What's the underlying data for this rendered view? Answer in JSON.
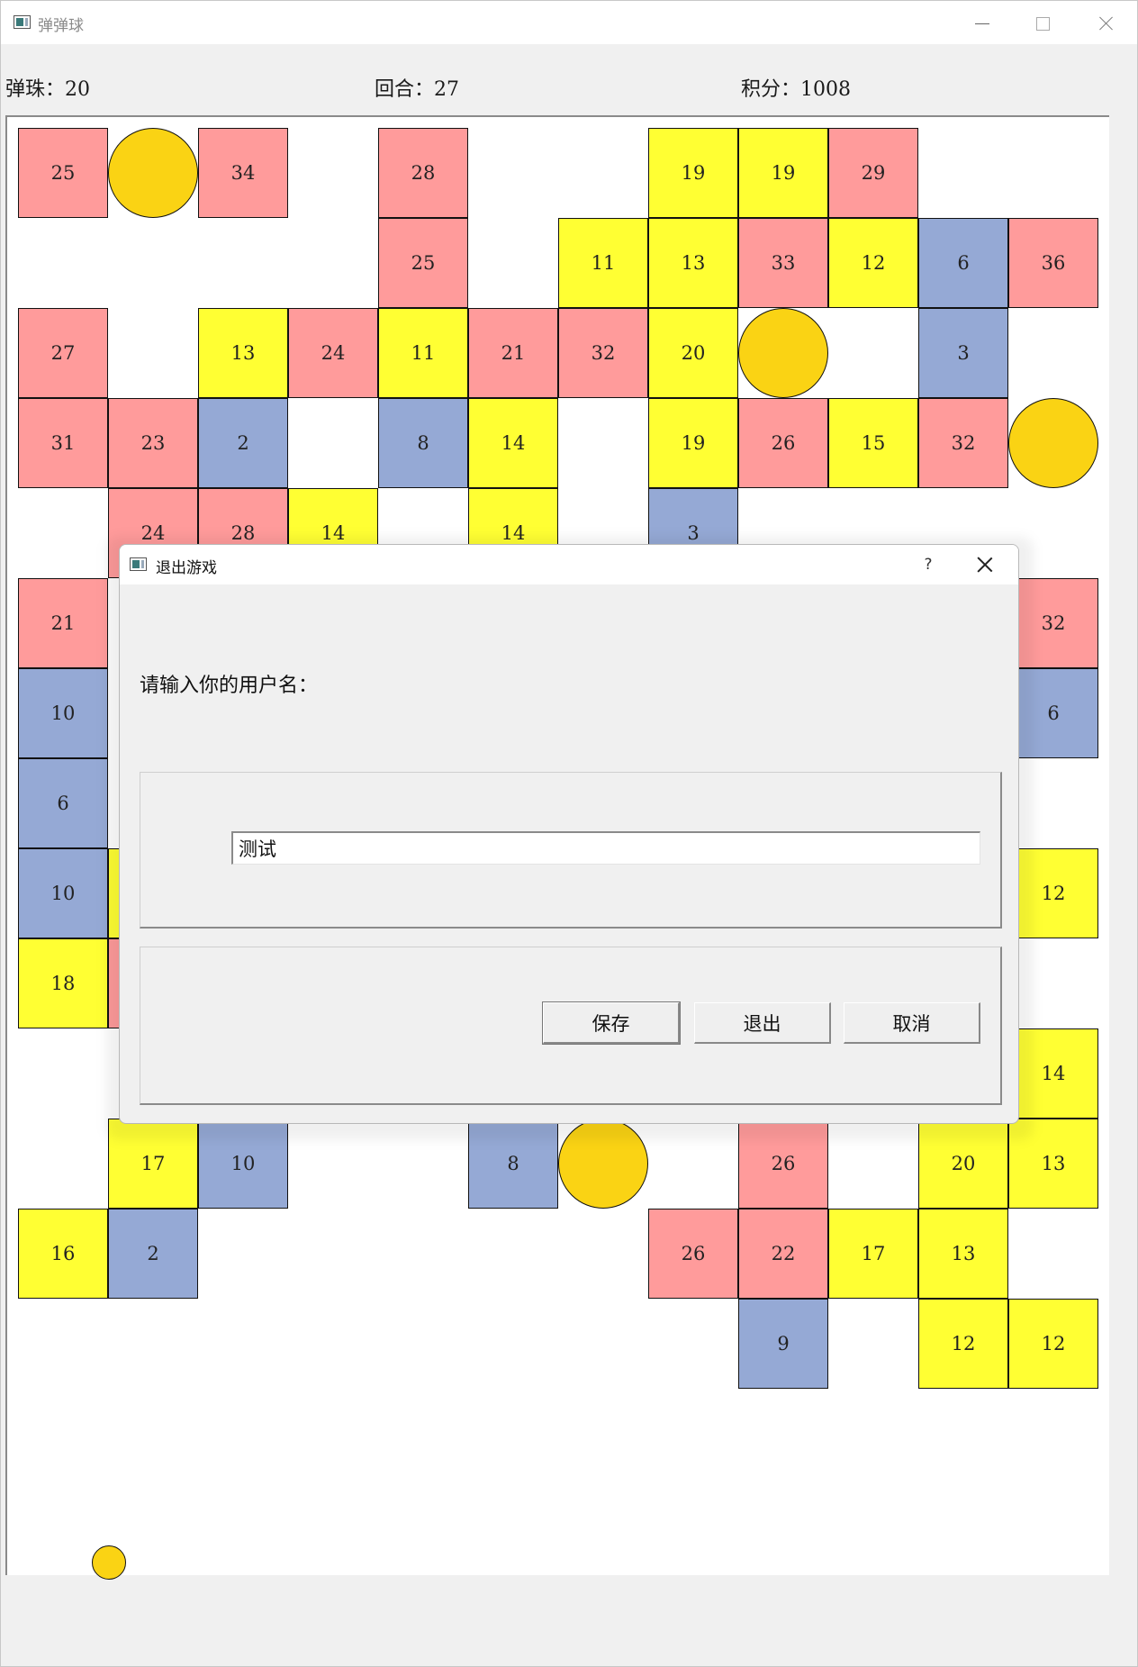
{
  "window": {
    "title": "弹弹球"
  },
  "stats": {
    "balls_text": "弹珠：20",
    "round_text": "回合：27",
    "score_text": "积分：1008"
  },
  "colors": {
    "pink": "#ff9b9b",
    "yellow": "#ffff33",
    "blue": "#95a9d5",
    "ball": "#fad314"
  },
  "blocks": [
    {
      "v": "25",
      "c": "pink",
      "col": 0,
      "row": 0
    },
    {
      "v": "34",
      "c": "pink",
      "col": 2,
      "row": 0
    },
    {
      "v": "28",
      "c": "pink",
      "col": 4,
      "row": 0
    },
    {
      "v": "19",
      "c": "yellow",
      "col": 7,
      "row": 0
    },
    {
      "v": "19",
      "c": "yellow",
      "col": 8,
      "row": 0
    },
    {
      "v": "29",
      "c": "pink",
      "col": 9,
      "row": 0
    },
    {
      "v": "25",
      "c": "pink",
      "col": 4,
      "row": 1
    },
    {
      "v": "11",
      "c": "yellow",
      "col": 6,
      "row": 1
    },
    {
      "v": "13",
      "c": "yellow",
      "col": 7,
      "row": 1
    },
    {
      "v": "33",
      "c": "pink",
      "col": 8,
      "row": 1
    },
    {
      "v": "12",
      "c": "yellow",
      "col": 9,
      "row": 1
    },
    {
      "v": "6",
      "c": "blue",
      "col": 10,
      "row": 1
    },
    {
      "v": "36",
      "c": "pink",
      "col": 11,
      "row": 1
    },
    {
      "v": "27",
      "c": "pink",
      "col": 0,
      "row": 2
    },
    {
      "v": "13",
      "c": "yellow",
      "col": 2,
      "row": 2
    },
    {
      "v": "24",
      "c": "pink",
      "col": 3,
      "row": 2
    },
    {
      "v": "11",
      "c": "yellow",
      "col": 4,
      "row": 2
    },
    {
      "v": "21",
      "c": "pink",
      "col": 5,
      "row": 2
    },
    {
      "v": "32",
      "c": "pink",
      "col": 6,
      "row": 2
    },
    {
      "v": "20",
      "c": "yellow",
      "col": 7,
      "row": 2
    },
    {
      "v": "3",
      "c": "blue",
      "col": 10,
      "row": 2
    },
    {
      "v": "31",
      "c": "pink",
      "col": 0,
      "row": 3
    },
    {
      "v": "23",
      "c": "pink",
      "col": 1,
      "row": 3
    },
    {
      "v": "2",
      "c": "blue",
      "col": 2,
      "row": 3
    },
    {
      "v": "8",
      "c": "blue",
      "col": 4,
      "row": 3
    },
    {
      "v": "14",
      "c": "yellow",
      "col": 5,
      "row": 3
    },
    {
      "v": "19",
      "c": "yellow",
      "col": 7,
      "row": 3
    },
    {
      "v": "26",
      "c": "pink",
      "col": 8,
      "row": 3
    },
    {
      "v": "15",
      "c": "yellow",
      "col": 9,
      "row": 3
    },
    {
      "v": "32",
      "c": "pink",
      "col": 10,
      "row": 3
    },
    {
      "v": "24",
      "c": "pink",
      "col": 1,
      "row": 4
    },
    {
      "v": "28",
      "c": "pink",
      "col": 2,
      "row": 4
    },
    {
      "v": "14",
      "c": "yellow",
      "col": 3,
      "row": 4
    },
    {
      "v": "14",
      "c": "yellow",
      "col": 5,
      "row": 4
    },
    {
      "v": "3",
      "c": "blue",
      "col": 7,
      "row": 4
    },
    {
      "v": "21",
      "c": "pink",
      "col": 0,
      "row": 5
    },
    {
      "v": "32",
      "c": "pink",
      "col": 11,
      "row": 5
    },
    {
      "v": "10",
      "c": "blue",
      "col": 0,
      "row": 6
    },
    {
      "v": "6",
      "c": "blue",
      "col": 11,
      "row": 6
    },
    {
      "v": "6",
      "c": "blue",
      "col": 0,
      "row": 7
    },
    {
      "v": "10",
      "c": "blue",
      "col": 0,
      "row": 8
    },
    {
      "v": "",
      "c": "yellow",
      "col": 1,
      "row": 8
    },
    {
      "v": "12",
      "c": "yellow",
      "col": 11,
      "row": 8
    },
    {
      "v": "18",
      "c": "yellow",
      "col": 0,
      "row": 9
    },
    {
      "v": "",
      "c": "pink",
      "col": 1,
      "row": 9
    },
    {
      "v": "14",
      "c": "yellow",
      "col": 11,
      "row": 10
    },
    {
      "v": "17",
      "c": "yellow",
      "col": 1,
      "row": 11
    },
    {
      "v": "10",
      "c": "blue",
      "col": 2,
      "row": 11
    },
    {
      "v": "8",
      "c": "blue",
      "col": 5,
      "row": 11
    },
    {
      "v": "26",
      "c": "pink",
      "col": 8,
      "row": 11
    },
    {
      "v": "20",
      "c": "yellow",
      "col": 10,
      "row": 11
    },
    {
      "v": "13",
      "c": "yellow",
      "col": 11,
      "row": 11
    },
    {
      "v": "16",
      "c": "yellow",
      "col": 0,
      "row": 12
    },
    {
      "v": "2",
      "c": "blue",
      "col": 1,
      "row": 12
    },
    {
      "v": "26",
      "c": "pink",
      "col": 7,
      "row": 12
    },
    {
      "v": "22",
      "c": "pink",
      "col": 8,
      "row": 12
    },
    {
      "v": "17",
      "c": "yellow",
      "col": 9,
      "row": 12
    },
    {
      "v": "13",
      "c": "yellow",
      "col": 10,
      "row": 12
    },
    {
      "v": "9",
      "c": "blue",
      "col": 8,
      "row": 13
    },
    {
      "v": "12",
      "c": "yellow",
      "col": 10,
      "row": 13
    },
    {
      "v": "12",
      "c": "yellow",
      "col": 11,
      "row": 13
    }
  ],
  "bonus_balls": [
    {
      "col": 1,
      "row": 0
    },
    {
      "col": 8,
      "row": 2
    },
    {
      "col": 11,
      "row": 3
    },
    {
      "col": 6,
      "row": 11
    }
  ],
  "dialog": {
    "title": "退出游戏",
    "help": "?",
    "prompt": "请输入你的用户名：",
    "username_value": "测试",
    "save_label": "保存",
    "quit_label": "退出",
    "cancel_label": "取消"
  }
}
